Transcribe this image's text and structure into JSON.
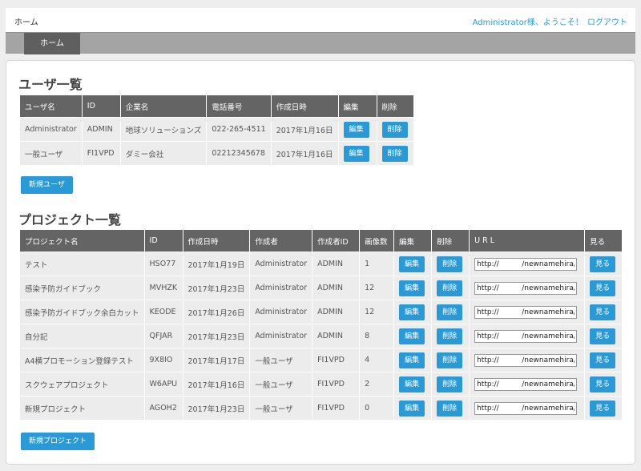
{
  "header": {
    "home_label": "ホーム",
    "welcome_text": "Administrator様、ようこそ！",
    "logout_label": "ログアウト"
  },
  "nav": {
    "tab_home": "ホーム"
  },
  "users": {
    "title": "ユーザ一覧",
    "columns": [
      "ユーザ名",
      "ID",
      "企業名",
      "電話番号",
      "作成日時",
      "編集",
      "削除"
    ],
    "rows": [
      {
        "name": "Administrator",
        "id": "ADMIN",
        "company": "地球ソリューションズ",
        "phone": "022-265-4511",
        "created": "2017年1月16日",
        "edit": "編集",
        "delete": "削除"
      },
      {
        "name": "一般ユーザ",
        "id": "FI1VPD",
        "company": "ダミー会社",
        "phone": "02212345678",
        "created": "2017年1月16日",
        "edit": "編集",
        "delete": "削除"
      }
    ],
    "new_button": "新規ユーザ"
  },
  "projects": {
    "title": "プロジェクト一覧",
    "columns": [
      "プロジェクト名",
      "ID",
      "作成日時",
      "作成者",
      "作成者ID",
      "画像数",
      "編集",
      "削除",
      "U R L",
      "見る"
    ],
    "rows": [
      {
        "name": "テスト",
        "id": "HSO77",
        "created": "2017年1月19日",
        "author": "Administrator",
        "author_id": "ADMIN",
        "images": "1",
        "edit": "編集",
        "delete": "削除",
        "url": "http://          /newnamehira/ho",
        "view": "見る"
      },
      {
        "name": "感染予防ガイドブック",
        "id": "MVHZK",
        "created": "2017年1月23日",
        "author": "Administrator",
        "author_id": "ADMIN",
        "images": "12",
        "edit": "編集",
        "delete": "削除",
        "url": "http://          /newnamehira/ho",
        "view": "見る"
      },
      {
        "name": "感染予防ガイドブック余白カット",
        "id": "KEODE",
        "created": "2017年1月26日",
        "author": "Administrator",
        "author_id": "ADMIN",
        "images": "12",
        "edit": "編集",
        "delete": "削除",
        "url": "http://          /newnamehira/ho",
        "view": "見る"
      },
      {
        "name": "自分記",
        "id": "QFJAR",
        "created": "2017年1月23日",
        "author": "Administrator",
        "author_id": "ADMIN",
        "images": "8",
        "edit": "編集",
        "delete": "削除",
        "url": "http://          /newnamehira/ho",
        "view": "見る"
      },
      {
        "name": "A4横プロモーション登録テスト",
        "id": "9X8IO",
        "created": "2017年1月17日",
        "author": "一般ユーザ",
        "author_id": "FI1VPD",
        "images": "4",
        "edit": "編集",
        "delete": "削除",
        "url": "http://          /newnamehira/ho",
        "view": "見る"
      },
      {
        "name": "スクウェアプロジェクト",
        "id": "W6APU",
        "created": "2017年1月16日",
        "author": "一般ユーザ",
        "author_id": "FI1VPD",
        "images": "2",
        "edit": "編集",
        "delete": "削除",
        "url": "http://          /newnamehira/ho",
        "view": "見る"
      },
      {
        "name": "新規プロジェクト",
        "id": "AGOH2",
        "created": "2017年1月23日",
        "author": "一般ユーザ",
        "author_id": "FI1VPD",
        "images": "0",
        "edit": "編集",
        "delete": "削除",
        "url": "http://          /newnamehira/ho",
        "view": "見る"
      }
    ],
    "new_button": "新規プロジェクト"
  },
  "colors": {
    "accent": "#2a9ad6",
    "header_bg": "#646464",
    "cell_bg": "#ececec",
    "nav_bg": "#a4a4a4",
    "nav_active": "#5f5f5f"
  }
}
